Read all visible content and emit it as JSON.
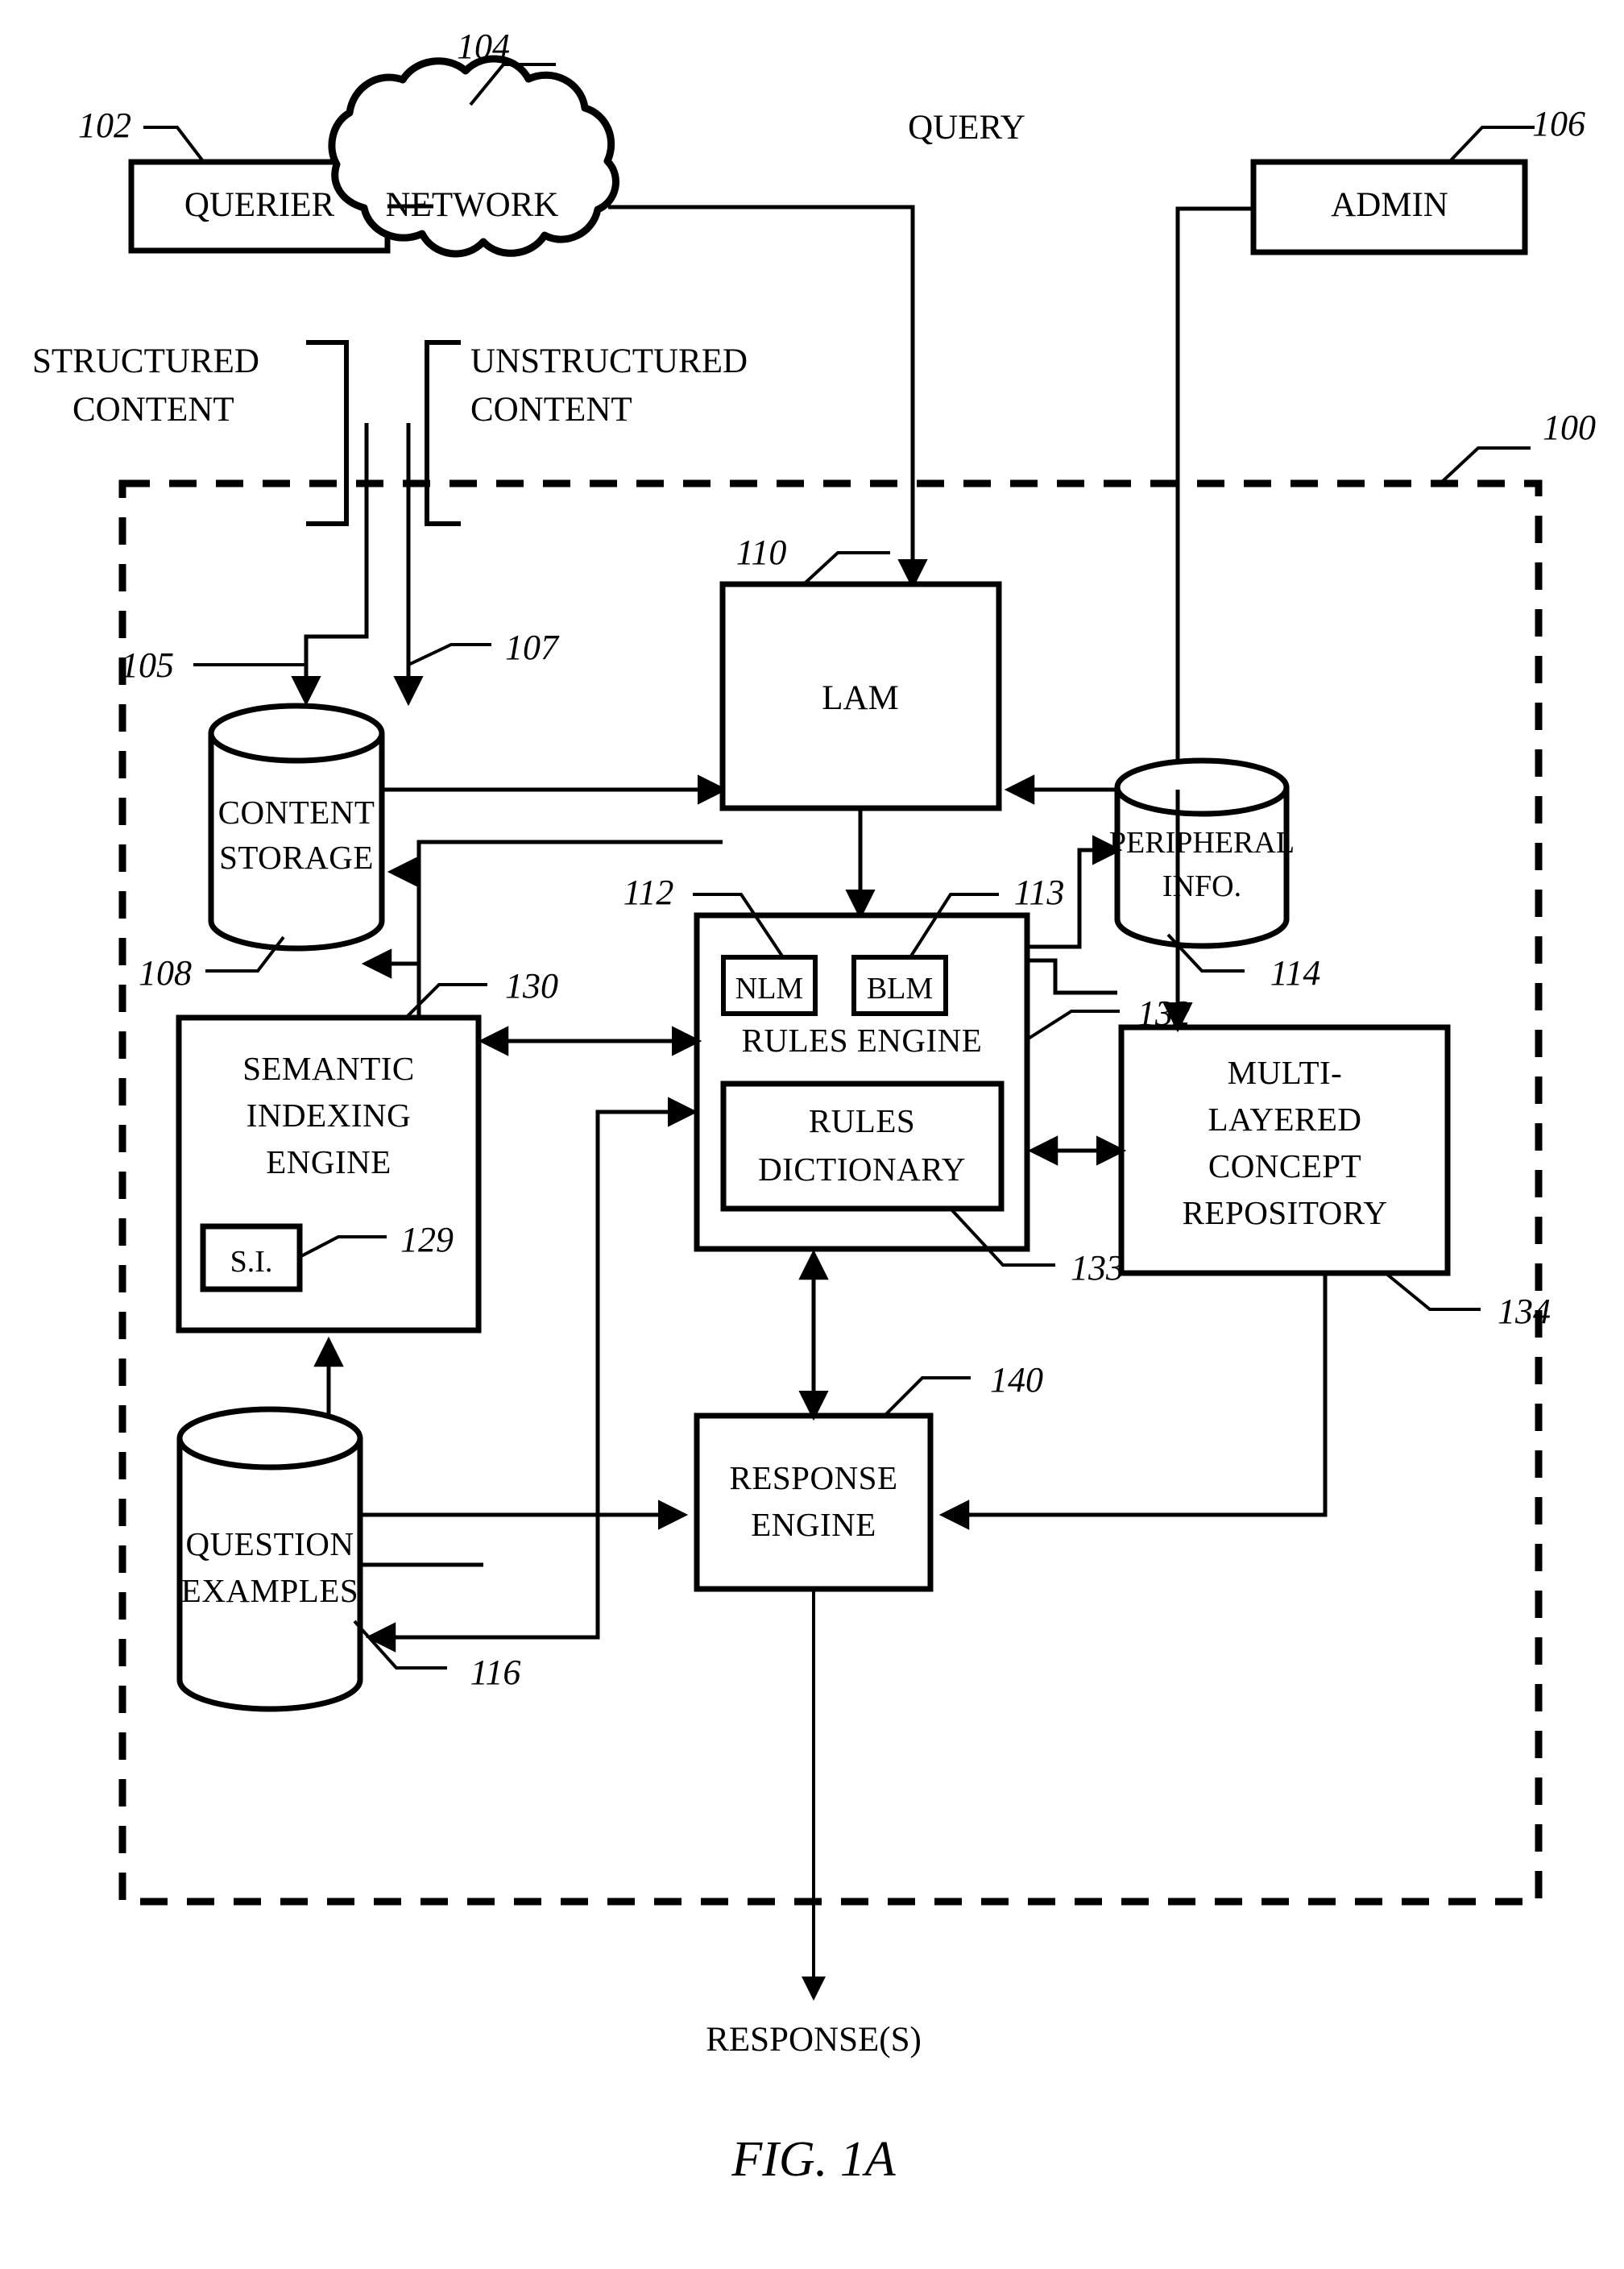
{
  "figure": {
    "caption": "FIG. 1A",
    "system_ref": "100"
  },
  "external": {
    "querier": {
      "label": "QUERIER",
      "ref": "102"
    },
    "network": {
      "label": "NETWORK",
      "ref": "104"
    },
    "admin": {
      "label": "ADMIN",
      "ref": "106"
    },
    "query_label": "QUERY",
    "structured_content": "STRUCTURED\nCONTENT",
    "structured_content_line1": "STRUCTURED",
    "structured_content_line2": "CONTENT",
    "unstructured_content_line1": "UNSTRUCTURED",
    "unstructured_content_line2": "CONTENT",
    "structured_feed_ref": "105",
    "unstructured_feed_ref": "107",
    "response_output": "RESPONSE(S)"
  },
  "nodes": {
    "content_storage": {
      "label_line1": "CONTENT",
      "label_line2": "STORAGE",
      "ref": "108",
      "shape": "cylinder"
    },
    "lam": {
      "label": "LAM",
      "ref": "110",
      "shape": "box"
    },
    "peripheral_info": {
      "label_line1": "PERIPHERAL",
      "label_line2": "INFO.",
      "ref": "114",
      "shape": "cylinder"
    },
    "rules_engine": {
      "label": "RULES ENGINE",
      "ref": "132",
      "shape": "box",
      "children": {
        "nlm": {
          "label": "NLM",
          "ref": "112"
        },
        "blm": {
          "label": "BLM",
          "ref": "113"
        },
        "rules_dictionary": {
          "label_line1": "RULES",
          "label_line2": "DICTIONARY",
          "ref": "133"
        }
      }
    },
    "semantic_indexing_engine": {
      "label_line1": "SEMANTIC",
      "label_line2": "INDEXING",
      "label_line3": "ENGINE",
      "ref": "130",
      "shape": "box",
      "children": {
        "si": {
          "label": "S.I.",
          "ref": "129"
        }
      }
    },
    "multi_layered_concept_repository": {
      "label_line1": "MULTI-",
      "label_line2": "LAYERED",
      "label_line3": "CONCEPT",
      "label_line4": "REPOSITORY",
      "ref": "134",
      "shape": "box"
    },
    "response_engine": {
      "label_line1": "RESPONSE",
      "label_line2": "ENGINE",
      "ref": "140",
      "shape": "box"
    },
    "question_examples": {
      "label_line1": "QUESTION",
      "label_line2": "EXAMPLES",
      "ref": "116",
      "shape": "cylinder"
    }
  },
  "colors": {
    "stroke": "#000000",
    "fill": "#ffffff"
  }
}
